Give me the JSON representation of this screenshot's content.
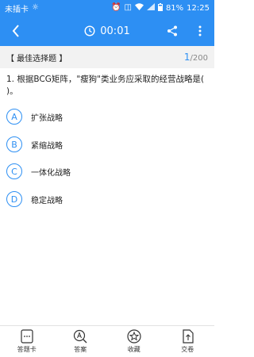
{
  "status_bar": {
    "carrier": "未插卡",
    "battery": "81%",
    "time": "12:25"
  },
  "top_bar": {
    "timer": "00:01"
  },
  "question_header": {
    "type_label": "【 最佳选择题 】",
    "current": "1",
    "total": "/200"
  },
  "question": {
    "text": "1. 根据BCG矩阵，\"瘦狗\"类业务应采取的经营战略是( )。"
  },
  "options": [
    {
      "letter": "A",
      "text": "扩张战略"
    },
    {
      "letter": "B",
      "text": "紧缩战略"
    },
    {
      "letter": "C",
      "text": "一体化战略"
    },
    {
      "letter": "D",
      "text": "稳定战略"
    }
  ],
  "bottom_tabs": [
    {
      "label": "答题卡",
      "icon": "answer-card-icon"
    },
    {
      "label": "答案",
      "icon": "answer-icon"
    },
    {
      "label": "收藏",
      "icon": "star-icon"
    },
    {
      "label": "交卷",
      "icon": "submit-icon"
    }
  ],
  "colors": {
    "accent": "#2d8ff3",
    "header_bg": "#f2f2f2"
  }
}
